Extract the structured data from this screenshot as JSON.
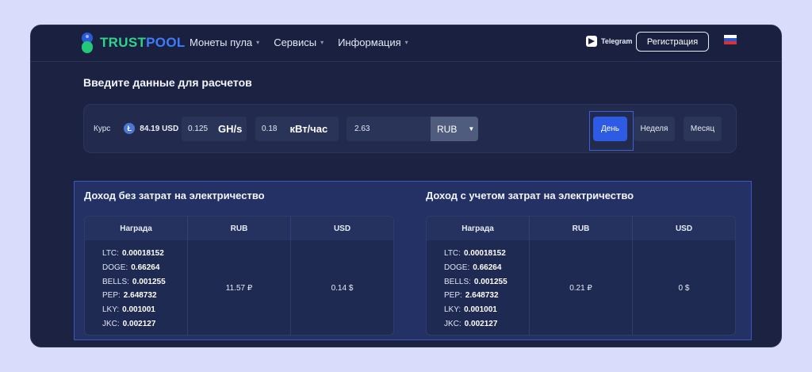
{
  "header": {
    "logo_part1": "TRUST",
    "logo_part2": "POOL",
    "nav": [
      {
        "label": "Монеты пула"
      },
      {
        "label": "Сервисы"
      },
      {
        "label": "Информация"
      }
    ],
    "telegram_label": "Telegram",
    "register_label": "Регистрация",
    "flag_colors": [
      "#ffffff",
      "#2f56c8",
      "#d8313a"
    ]
  },
  "page_title": "Введите данные для расчетов",
  "calculator": {
    "rate_label": "Курс",
    "rate_value": "84.19 USD",
    "coin_icon": "Ł",
    "hashrate_value": "0.125",
    "hashrate_unit": "GH/s",
    "power_value": "0.18",
    "power_unit": "кВт/час",
    "price_value": "2.63",
    "currency": "RUB",
    "periods": [
      "День",
      "Неделя",
      "Месяц"
    ],
    "active_period": "День"
  },
  "results": {
    "without_cost": {
      "title": "Доход без затрат на электричество",
      "headers": [
        "Награда",
        "RUB",
        "USD"
      ],
      "rewards": [
        {
          "coin": "LTC:",
          "amount": "0.00018152"
        },
        {
          "coin": "DOGE:",
          "amount": "0.66264"
        },
        {
          "coin": "BELLS:",
          "amount": "0.001255"
        },
        {
          "coin": "PEP:",
          "amount": "2.648732"
        },
        {
          "coin": "LKY:",
          "amount": "0.001001"
        },
        {
          "coin": "JKC:",
          "amount": "0.002127"
        }
      ],
      "rub": "11.57 ₽",
      "usd": "0.14 $"
    },
    "with_cost": {
      "title": "Доход с учетом затрат на электричество",
      "headers": [
        "Награда",
        "RUB",
        "USD"
      ],
      "rewards": [
        {
          "coin": "LTC:",
          "amount": "0.00018152"
        },
        {
          "coin": "DOGE:",
          "amount": "0.66264"
        },
        {
          "coin": "BELLS:",
          "amount": "0.001255"
        },
        {
          "coin": "PEP:",
          "amount": "2.648732"
        },
        {
          "coin": "LKY:",
          "amount": "0.001001"
        },
        {
          "coin": "JKC:",
          "amount": "0.002127"
        }
      ],
      "rub": "0.21 ₽",
      "usd": "0 $"
    }
  },
  "colors": {
    "accent": "#2d5be3",
    "logo_green": "#2fd38a",
    "logo_blue": "#3d7bff"
  }
}
